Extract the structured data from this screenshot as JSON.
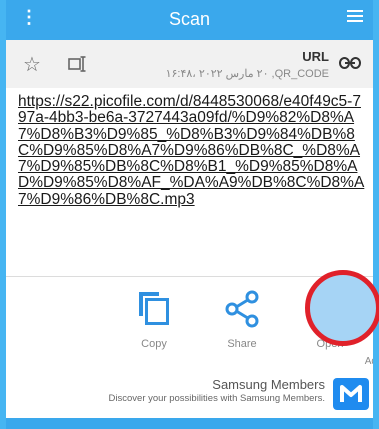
{
  "header": {
    "title": "Scan"
  },
  "info": {
    "type_label": "URL",
    "meta": "٢٠ مارس ٢٠٢٢ ،١۶:۴٨ ,QR_CODE"
  },
  "content": {
    "url": "https://s22.picofile.com/d/8448530068/e40f49c5-797a-4bb3-be6a-3727443a09fd/%D9%82%D8%A7%D8%B3%D9%85_%D8%B3%D9%84%DB%8C%D9%85%D8%A7%D9%86%DB%8C_%D8%A7%D9%85%DB%8C%D8%B1_%D9%85%D8%AD%D9%85%D8%AF_%DA%A9%DB%8C%D8%A7%D9%86%DB%8C.mp3"
  },
  "actions": [
    {
      "label": "Copy"
    },
    {
      "label": "Share"
    },
    {
      "label": "Open"
    }
  ],
  "ad": {
    "marker": "Ad",
    "title": "Samsung Members",
    "subtitle": "Discover your possibilities with Samsung Members."
  },
  "colors": {
    "accent": "#3aa8ec",
    "frame": "#46b5f2",
    "action_icon": "#2f90e0",
    "overlay_ring": "#e0212a"
  }
}
